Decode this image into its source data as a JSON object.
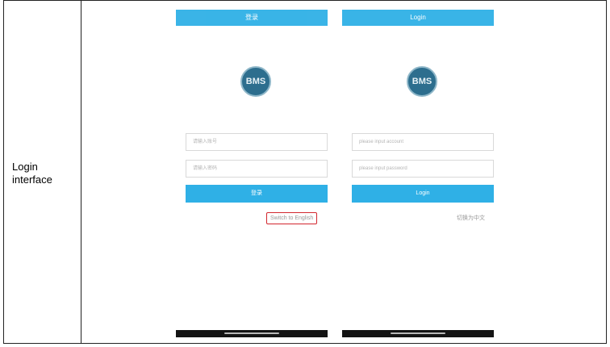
{
  "table": {
    "row_label": "Login\ninterface"
  },
  "cn": {
    "title": "登录",
    "logo_text": "BMS",
    "username_placeholder": "请输入账号",
    "password_placeholder": "请输入密码",
    "login_button": "登录",
    "language_link": "Switch to English"
  },
  "en": {
    "title": "Login",
    "logo_text": "BMS",
    "username_placeholder": "please input account",
    "password_placeholder": "please input password",
    "login_button": "Login",
    "language_link": "切换为中文"
  },
  "colors": {
    "accent": "#2fb0e6",
    "highlight": "#d2262e",
    "logo": "#2d6e8e"
  }
}
